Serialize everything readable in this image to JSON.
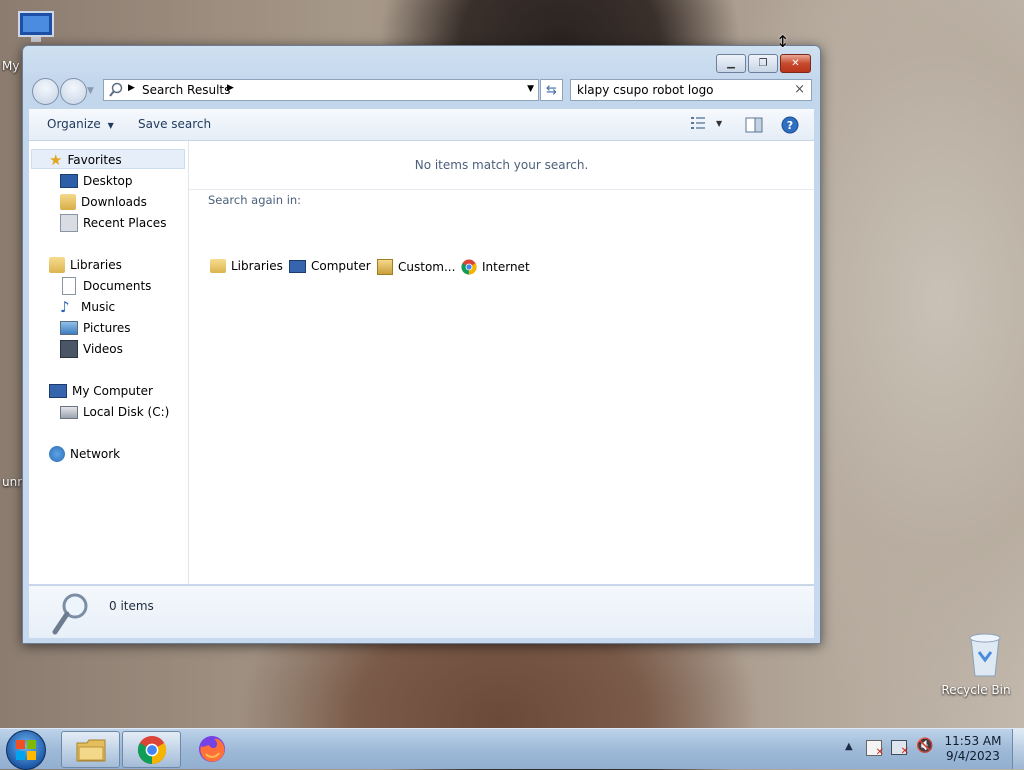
{
  "desktop": {
    "icons": [
      {
        "label": "My"
      },
      {
        "label": "Recycle Bin"
      }
    ],
    "left_fragment": "unr"
  },
  "window": {
    "address": {
      "crumb": "Search Results"
    },
    "search": {
      "value": "klapy csupo robot logo",
      "clear": "×"
    },
    "toolbar": {
      "organize": "Organize",
      "save_search": "Save search"
    },
    "nav": {
      "favorites": "Favorites",
      "desktop": "Desktop",
      "downloads": "Downloads",
      "recent": "Recent Places",
      "libraries": "Libraries",
      "documents": "Documents",
      "music": "Music",
      "pictures": "Pictures",
      "videos": "Videos",
      "computer": "My Computer",
      "local_disk": "Local Disk (C:)",
      "network": "Network"
    },
    "main": {
      "empty_message": "No items match your search.",
      "search_again": "Search again in:",
      "locations": [
        {
          "label": "Libraries"
        },
        {
          "label": "Computer"
        },
        {
          "label": "Custom..."
        },
        {
          "label": "Internet"
        }
      ]
    },
    "status": {
      "count": "0 items"
    }
  },
  "taskbar": {
    "clock_time": "11:53 AM",
    "clock_date": "9/4/2023"
  }
}
